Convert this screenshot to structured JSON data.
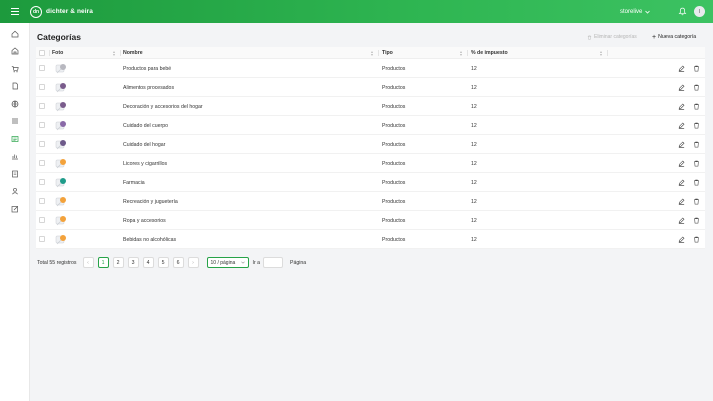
{
  "header": {
    "logo_mark": "dn",
    "brand": "dichter & neira",
    "store_name": "storelive",
    "avatar_initial": "I"
  },
  "sidebar": {
    "items": [
      {
        "icon": "home-icon"
      },
      {
        "icon": "store-icon"
      },
      {
        "icon": "cart-icon"
      },
      {
        "icon": "document-icon"
      },
      {
        "icon": "globe-icon"
      },
      {
        "icon": "list-icon"
      },
      {
        "icon": "catalog-icon",
        "active": true
      },
      {
        "icon": "chart-icon"
      },
      {
        "icon": "report-icon"
      },
      {
        "icon": "user-icon"
      },
      {
        "icon": "edit-icon"
      }
    ]
  },
  "page": {
    "title": "Categorías",
    "delete_label": "Eliminar categorías",
    "new_label": "Nueva categoría"
  },
  "table": {
    "columns": [
      "Foto",
      "Nombre",
      "Tipo",
      "% de impuesto"
    ],
    "rows": [
      {
        "name": "Productos para bebé",
        "type": "Productos",
        "tax": "12",
        "icon_color": "#b8b8c0"
      },
      {
        "name": "Alimentos procesados",
        "type": "Productos",
        "tax": "12",
        "icon_color": "#7a5c8c"
      },
      {
        "name": "Decoración y accesorios del hogar",
        "type": "Productos",
        "tax": "12",
        "icon_color": "#7a5c8c"
      },
      {
        "name": "Cuidado del cuerpo",
        "type": "Productos",
        "tax": "12",
        "icon_color": "#8a6aa8"
      },
      {
        "name": "Cuidado del hogar",
        "type": "Productos",
        "tax": "12",
        "icon_color": "#6e5a8a"
      },
      {
        "name": "Licores y cigarrillos",
        "type": "Productos",
        "tax": "12",
        "icon_color": "#f3a23b"
      },
      {
        "name": "Farmacia",
        "type": "Productos",
        "tax": "12",
        "icon_color": "#1f9c8a"
      },
      {
        "name": "Recreación y juguetería",
        "type": "Productos",
        "tax": "12",
        "icon_color": "#f3a23b"
      },
      {
        "name": "Ropa y accesorios",
        "type": "Productos",
        "tax": "12",
        "icon_color": "#f3a23b"
      },
      {
        "name": "Bebidas no alcohólicas",
        "type": "Productos",
        "tax": "12",
        "icon_color": "#f3a23b"
      }
    ]
  },
  "pagination": {
    "total_label": "Total 55 registros",
    "pages": [
      "1",
      "2",
      "3",
      "4",
      "5",
      "6"
    ],
    "current": "1",
    "prev": "‹",
    "next": "›",
    "per_page": "10 / página",
    "goto_label": "Ir a",
    "page_label": "Página"
  },
  "colors": {
    "brand": "#2fb652",
    "accent": "#27a348"
  }
}
